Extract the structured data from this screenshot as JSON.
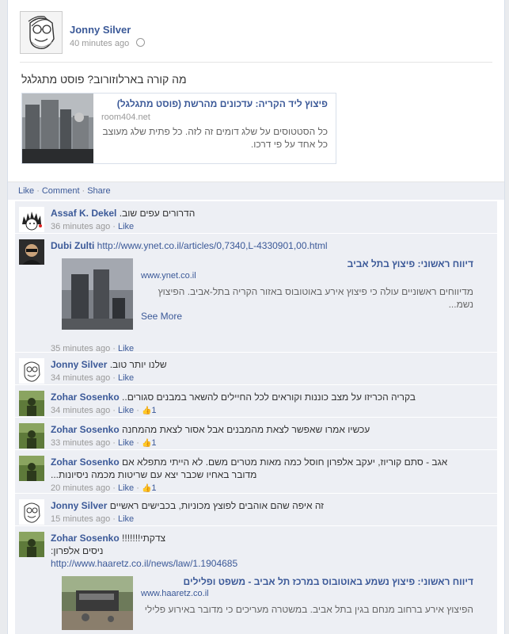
{
  "post": {
    "author": "Jonny Silver",
    "time": "40 minutes ago",
    "text": "מה קורה בארלוזורוב? פוסט מתגלגל",
    "share": {
      "title": "פיצוץ ליד הקריה: עדכונים מהרשת (פוסט מתגלגל)",
      "domain": "room404.net",
      "desc": "כל הסטטוסים על שלג דומים זה לזה. כל פתית שלג מעוצב כל אחד על פי דרכו."
    }
  },
  "actions": {
    "like": "Like",
    "comment": "Comment",
    "share": "Share",
    "sep": "·"
  },
  "comments": [
    {
      "name": "Assaf K. Dekel",
      "text": "הדרורים עפים שוב.",
      "time": "36 minutes ago",
      "like": "Like"
    },
    {
      "name": "Dubi Zulti",
      "url": "http://www.ynet.co.il/articles/0,7340,L-4330901,00.html",
      "time": "35 minutes ago",
      "like": "Like",
      "link": {
        "title": "דיווח ראשוני: פיצוץ בתל אביב",
        "domain": "www.ynet.co.il",
        "desc": "מדיווחים ראשוניים עולה כי פיצוץ אירע באוטובוס באזור הקריה בתל-אביב. הפיצוץ נשמ...",
        "more": "See More"
      }
    },
    {
      "name": "Jonny Silver",
      "text": "שלנו יותר טוב.",
      "time": "34 minutes ago",
      "like": "Like"
    },
    {
      "name": "Zohar Sosenko",
      "text": "בקריה הכריזו על מצב כוננות וקוראים לכל החיילים להשאר במבנים סגורים..",
      "time": "34 minutes ago",
      "like": "Like",
      "likes": "1"
    },
    {
      "name": "Zohar Sosenko",
      "text": "עכשיו אמרו שאפשר לצאת מהמבנים אבל אסור לצאת מהמחנה",
      "time": "33 minutes ago",
      "like": "Like",
      "likes": "1"
    },
    {
      "name": "Zohar Sosenko",
      "text": "אגב - סתם קוריוז, יעקב אלפרון חוסל כמה מאות מטרים משם. לא הייתי מתפלא אם",
      "text2": "מדובר באחיו שכבר יצא עם שריטות מכמה ניסיונות...",
      "time": "20 minutes ago",
      "like": "Like",
      "likes": "1"
    },
    {
      "name": "Jonny Silver",
      "text": "זה איפה שהם אוהבים לפוצץ מכוניות, בכבישים ראשיים",
      "time": "15 minutes ago",
      "like": "Like"
    },
    {
      "name": "Zohar Sosenko",
      "text": "צדקתי!!!!!!!",
      "text2": "ניסים אלפרון:",
      "url": "http://www.haaretz.co.il/news/law/1.1904685",
      "link": {
        "title": "דיווח ראשוני: פיצוץ נשמע באוטובוס במרכז תל אביב - משפט ופלילים",
        "domain": "www.haaretz.co.il",
        "desc": "הפיצוץ אירע ברחוב מנחם בגין בתל אביב. במשטרה מעריכים כי מדובר באירוע פלילי"
      }
    }
  ],
  "colors": {
    "link": "#3b5998",
    "bg": "#edeff4"
  },
  "icons": {
    "like": "thumbs-up-icon",
    "privacy": "globe-icon"
  }
}
